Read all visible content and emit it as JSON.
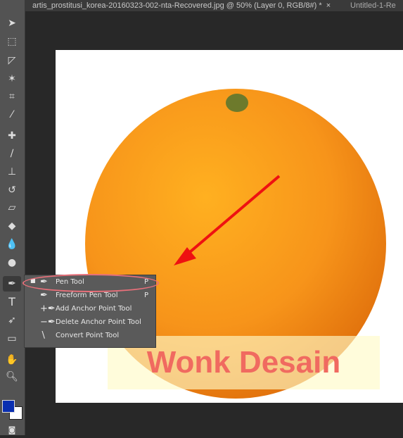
{
  "tabs": [
    {
      "label": "artis_prostitusi_korea-20160323-002-nta-Recovered.jpg @ 50% (Layer 0, RGB/8#) *",
      "close": "×"
    },
    {
      "label": "Untitled-1-Re"
    }
  ],
  "flyout": {
    "items": [
      {
        "label": "Pen Tool",
        "shortcut": "P",
        "selected": true,
        "icon": "pen-icon"
      },
      {
        "label": "Freeform Pen Tool",
        "shortcut": "P",
        "icon": "freeform-pen-icon"
      },
      {
        "label": "Add Anchor Point Tool",
        "shortcut": "",
        "icon": "add-anchor-icon"
      },
      {
        "label": "Delete Anchor Point Tool",
        "shortcut": "",
        "icon": "delete-anchor-icon"
      },
      {
        "label": "Convert Point Tool",
        "shortcut": "",
        "icon": "convert-point-icon"
      }
    ]
  },
  "watermark": "Wonk Desain",
  "colors": {
    "foreground": "#0a2fb0",
    "background": "#ffffff",
    "highlight": "#e8707a",
    "arrow": "#ee1111"
  }
}
